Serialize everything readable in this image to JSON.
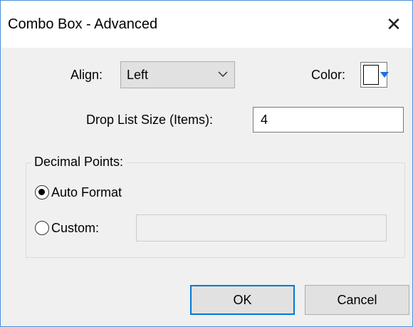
{
  "window": {
    "title": "Combo Box - Advanced",
    "close_icon": "close-icon"
  },
  "align": {
    "label": "Align:",
    "value": "Left"
  },
  "color": {
    "label": "Color:",
    "swatch": "#ffffff",
    "arrow_color": "#1e6ee6"
  },
  "drop_list": {
    "label": "Drop List Size (Items):",
    "value": "4"
  },
  "decimal_points": {
    "title": "Decimal Points:",
    "auto_format_label": "Auto Format",
    "custom_label": "Custom:",
    "selected": "auto_format",
    "custom_value": ""
  },
  "buttons": {
    "ok_label": "OK",
    "cancel_label": "Cancel"
  },
  "colors": {
    "accent": "#0078d7",
    "window_border": "#4a90d9",
    "dialog_bg": "#f0f0f0"
  }
}
